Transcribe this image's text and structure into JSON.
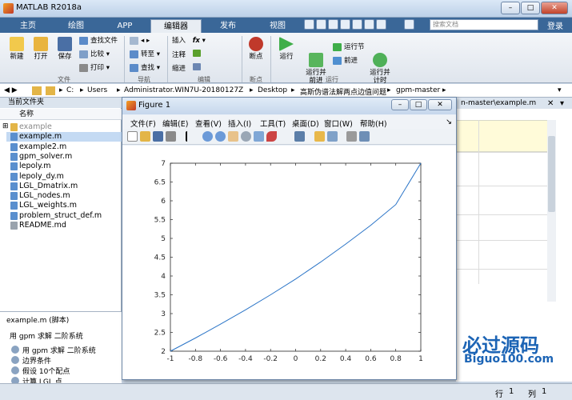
{
  "window": {
    "title": "MATLAB R2018a"
  },
  "tabs": [
    "主页",
    "绘图",
    "APP",
    "编辑器",
    "发布",
    "视图"
  ],
  "active_tab": 3,
  "search": {
    "placeholder": "搜索文档"
  },
  "login": "登录",
  "ribbon": {
    "file": {
      "new": "新建",
      "open": "打开",
      "save": "保存",
      "find_files": "查找文件",
      "compare": "比较",
      "print": "打印",
      "group": "文件"
    },
    "nav": {
      "goto": "转至",
      "find": "查找",
      "group": "导航"
    },
    "edit": {
      "insert": "插入",
      "comment": "注释",
      "indent": "缩进",
      "group": "编辑"
    },
    "breakpoint": {
      "label": "断点",
      "group": "断点"
    },
    "run": {
      "run": "运行",
      "run_advance": "运行并\n前进",
      "run_section": "运行节",
      "advance": "前进",
      "run_time": "运行并\n计时",
      "group": "运行"
    }
  },
  "address": {
    "parts": [
      "C:",
      "Users",
      "Administrator.WIN7U-20180127Z",
      "Desktop",
      "高斯伪谱法解两点边值问题",
      "gpm-master"
    ]
  },
  "left_panel": {
    "title": "当前文件夹",
    "column": "名称",
    "files": [
      "example",
      "example.m",
      "example2.m",
      "gpm_solver.m",
      "lepoly.m",
      "lepoly_dy.m",
      "LGL_Dmatrix.m",
      "LGL_nodes.m",
      "LGL_weights.m",
      "problem_struct_def.m",
      "README.md"
    ],
    "selected": 1
  },
  "detail": {
    "title": "example.m  (脚本)",
    "desc": "用 gpm 求解 二阶系统",
    "items": [
      "用 gpm 求解 二阶系统",
      "边界条件",
      "假设 10个配点",
      "计算 LGL 点"
    ]
  },
  "editor": {
    "tab": "n-master\\example.m"
  },
  "status": {
    "row_label": "行",
    "row": "1",
    "col_label": "列",
    "col": "1"
  },
  "figure": {
    "title": "Figure 1",
    "menu": [
      "文件(F)",
      "编辑(E)",
      "查看(V)",
      "插入(I)",
      "工具(T)",
      "桌面(D)",
      "窗口(W)",
      "帮助(H)"
    ]
  },
  "watermark": {
    "text": "必过源码",
    "url": "Biguo100.com"
  },
  "colors": {
    "line": "#2a74c7",
    "tabbar": "#3a6798"
  },
  "chart_data": {
    "type": "line",
    "title": "",
    "xlabel": "",
    "ylabel": "",
    "xlim": [
      -1,
      1
    ],
    "ylim": [
      2,
      7
    ],
    "xticks": [
      "-1",
      "-0.8",
      "-0.6",
      "-0.4",
      "-0.2",
      "0",
      "0.2",
      "0.4",
      "0.6",
      "0.8",
      "1"
    ],
    "yticks": [
      "2",
      "2.5",
      "3",
      "3.5",
      "4",
      "4.5",
      "5",
      "5.5",
      "6",
      "6.5",
      "7"
    ],
    "x": [
      -1,
      -0.8,
      -0.6,
      -0.4,
      -0.2,
      0,
      0.2,
      0.4,
      0.6,
      0.8,
      1
    ],
    "y": [
      2.0,
      2.35,
      2.72,
      3.1,
      3.5,
      3.92,
      4.37,
      4.85,
      5.35,
      5.9,
      7.0
    ],
    "grid": false
  }
}
